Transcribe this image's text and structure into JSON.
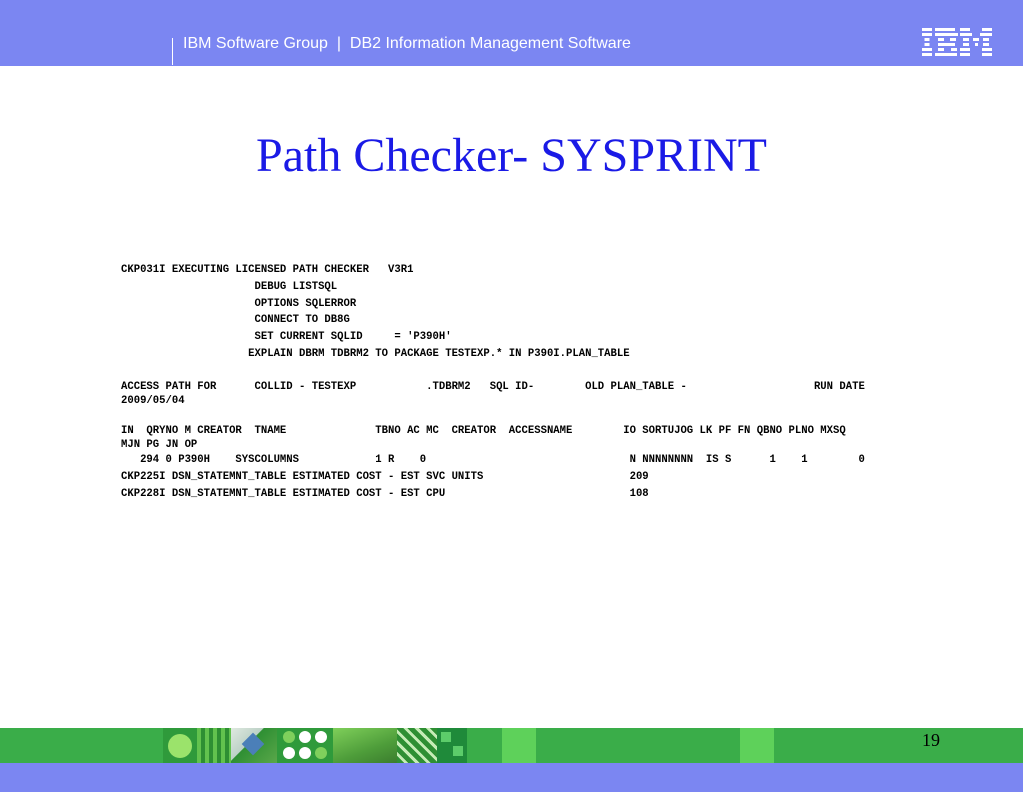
{
  "header": {
    "text": "IBM Software Group  |  DB2 Information Management Software",
    "logo": "IBM"
  },
  "slide": {
    "title": "Path Checker- SYSPRINT",
    "page_number": "19"
  },
  "sysprint": {
    "lines": [
      "CKP031I EXECUTING LICENSED PATH CHECKER   V3R1",
      "                     DEBUG LISTSQL",
      "                     OPTIONS SQLERROR",
      "                     CONNECT TO DB8G",
      "                     SET CURRENT SQLID     = 'P390H'",
      "                    EXPLAIN DBRM TDBRM2 TO PACKAGE TESTEXP.* IN P390I.PLAN_TABLE",
      "",
      "ACCESS PATH FOR      COLLID - TESTEXP           .TDBRM2   SQL ID-        OLD PLAN_TABLE -                    RUN DATE",
      "2009/05/04",
      "",
      "IN  QRYNO M CREATOR  TNAME              TBNO AC MC  CREATOR  ACCESSNAME        IO SORTUJOG LK PF FN QBNO PLNO MXSQ",
      "MJN PG JN OP",
      "   294 0 P390H    SYSCOLUMNS            1 R    0                                N NNNNNNNN  IS S      1    1        0",
      "CKP225I DSN_STATEMNT_TABLE ESTIMATED COST - EST SVC UNITS                       209",
      "CKP228I DSN_STATEMNT_TABLE ESTIMATED COST - EST CPU                             108"
    ]
  },
  "colors": {
    "header_bar": "#7b86f2",
    "footer_green": "#3aad49",
    "title": "#1a1ae6"
  }
}
